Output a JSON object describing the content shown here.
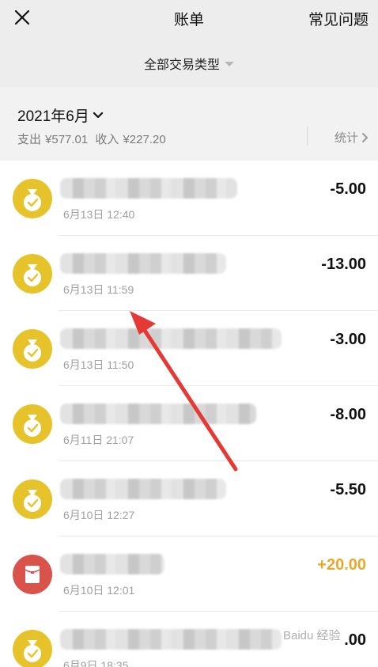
{
  "header": {
    "close_icon": "close-icon",
    "title": "账单",
    "faq": "常见问题"
  },
  "filter": {
    "label": "全部交易类型",
    "icon": "caret-down-icon"
  },
  "summary": {
    "month": "2021年6月",
    "expense_label": "支出",
    "expense_amount": "¥577.01",
    "income_label": "收入",
    "income_amount": "¥227.20",
    "stats_label": "统计"
  },
  "transactions": [
    {
      "icon": "money-bag-icon",
      "name": "",
      "time": "6月13日 12:40",
      "amount": "-5.00"
    },
    {
      "icon": "money-bag-icon",
      "name": "",
      "time": "6月13日 11:59",
      "amount": "-13.00"
    },
    {
      "icon": "money-bag-icon",
      "name": "",
      "time": "6月13日 11:50",
      "amount": "-3.00"
    },
    {
      "icon": "money-bag-icon",
      "name": "",
      "time": "6月11日 21:07",
      "amount": "-8.00"
    },
    {
      "icon": "money-bag-icon",
      "name": "",
      "time": "6月10日 12:27",
      "amount": "-5.50"
    },
    {
      "icon": "red-packet-icon",
      "name": "",
      "time": "6月10日 12:01",
      "amount": "+20.00"
    },
    {
      "icon": "money-bag-icon",
      "name": "",
      "time": "6月9日 18:35",
      "amount": ".00"
    }
  ],
  "colors": {
    "header_bg": "#ededed",
    "summary_bg": "#f2f2f2",
    "icon_yellow": "#e6c32b",
    "icon_red": "#d9534a",
    "income_amount": "#e8a92b",
    "annotation_arrow": "#e53935"
  },
  "watermark": "Baidu 经验"
}
